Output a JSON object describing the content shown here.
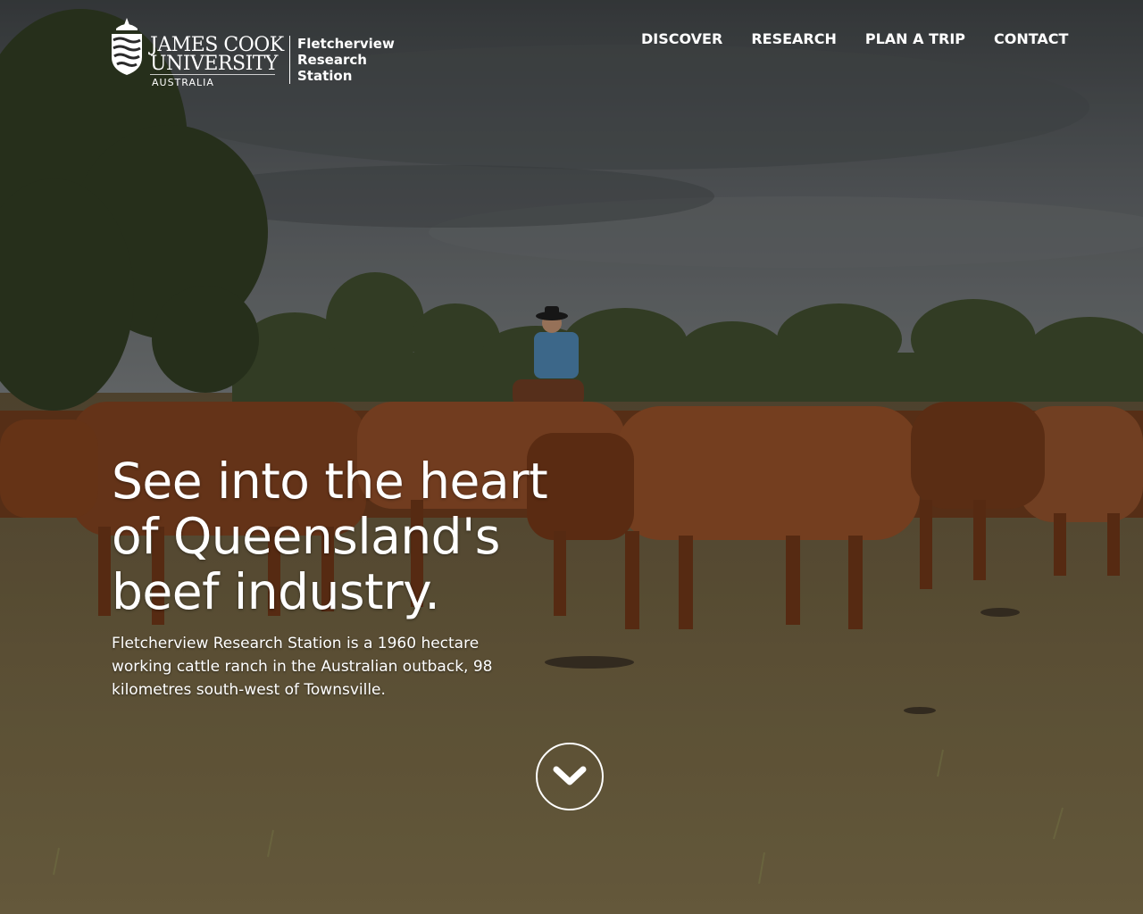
{
  "branding": {
    "university_line1": "JAMES COOK",
    "university_line2": "UNIVERSITY",
    "country": "AUSTRALIA",
    "station_line1": "Fletcherview",
    "station_line2": "Research",
    "station_line3": "Station",
    "crest_icon": "jcu-crest-icon"
  },
  "nav": {
    "items": [
      {
        "label": "DISCOVER"
      },
      {
        "label": "RESEARCH"
      },
      {
        "label": "PLAN A TRIP"
      },
      {
        "label": "CONTACT"
      }
    ]
  },
  "hero": {
    "headline_lines": [
      "See into the heart",
      "of Queensland's",
      "beef industry."
    ],
    "intro_lines": [
      "Fletcherview Research Station is a 1960 hectare",
      "working cattle ranch in the Australian outback, 98",
      "kilometres south-west of Townsville."
    ],
    "scroll_icon": "chevron-down-icon",
    "background_image": "cattle-herd-photo"
  },
  "colors": {
    "text": "#ffffff",
    "sky": "#55595c",
    "ground": "#6b5a3e",
    "cattle": "#8a4a24"
  }
}
